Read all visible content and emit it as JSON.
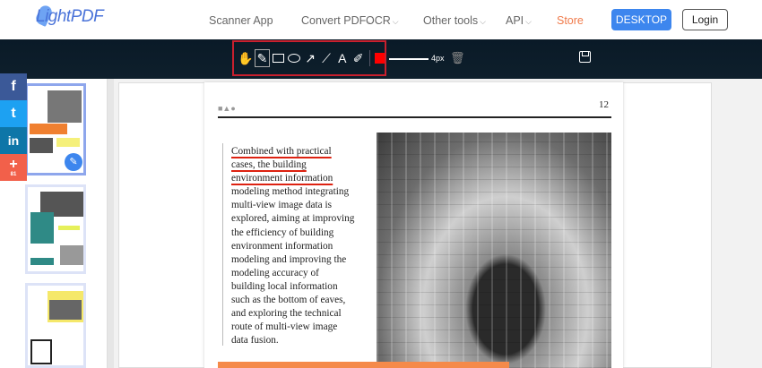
{
  "header": {
    "logo": "LightPDF",
    "nav": [
      {
        "label": "Scanner App",
        "chevron": false
      },
      {
        "label": "Convert PDF",
        "chevron": true
      },
      {
        "label": "OCR",
        "chevron": true
      },
      {
        "label": "Other tools",
        "chevron": true
      },
      {
        "label": "API",
        "chevron": true
      }
    ],
    "store": "Store",
    "desktop": "DESKTOP",
    "login": "Login"
  },
  "toolbar": {
    "tools": [
      "hand",
      "pencil",
      "rectangle",
      "ellipse",
      "arrow",
      "line",
      "text",
      "highlighter"
    ],
    "text_tool": "A",
    "color": "#ff0000",
    "stroke_size": "4px"
  },
  "share": {
    "count": "81"
  },
  "document": {
    "page_number": "12",
    "highlighted": [
      "Combined with practical",
      "cases, the building",
      "environment information"
    ],
    "lines": [
      "modeling method integrating",
      "multi-view image data is",
      "explored, aiming at improving",
      "the efficiency of building",
      "environment information",
      "modeling and improving the",
      "modeling accuracy of",
      "building local information",
      "such as the bottom of eaves,",
      "and exploring the technical",
      "route of multi-view image",
      "data fusion."
    ]
  }
}
